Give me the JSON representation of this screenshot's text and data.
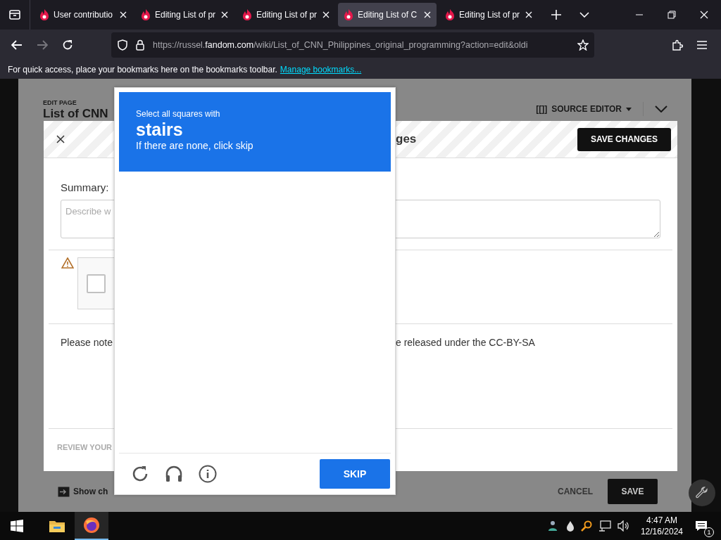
{
  "browser": {
    "tabs": [
      {
        "title": "User contributio",
        "selected": false
      },
      {
        "title": "Editing List of pr",
        "selected": false
      },
      {
        "title": "Editing List of pr",
        "selected": false
      },
      {
        "title": "Editing List of C",
        "selected": true
      },
      {
        "title": "Editing List of pr",
        "selected": false
      }
    ],
    "forward_disabled": true,
    "url": {
      "prefix": "https://russel.",
      "domain": "fandom.com",
      "path": "/wiki/List_of_CNN_Philippines_original_programming?action=edit&oldi"
    },
    "bookmarks_bar": {
      "message": "For quick access, place your bookmarks here on the bookmarks toolbar.",
      "link": "Manage bookmarks..."
    }
  },
  "editor": {
    "eyebrow": "EDIT PAGE",
    "title": "List of CNN",
    "mode_icon": "[[]]",
    "mode": "SOURCE EDITOR"
  },
  "save_dialog": {
    "title": "ges",
    "save_button": "SAVE CHANGES",
    "summary_label": "Summary:",
    "summary_placeholder": "Describe w",
    "captcha_checked": false,
    "notice_start": "Please note",
    "notice_end": "e released under the CC-BY-SA",
    "review_label": "REVIEW YOUR"
  },
  "footer": {
    "show_changes": "Show ch",
    "cancel": "CANCEL",
    "save": "SAVE"
  },
  "captcha": {
    "prompt": "Select all squares with",
    "target": "stairs",
    "hint": "If there are none, click skip",
    "skip_button": "SKIP"
  },
  "taskbar": {
    "time": "4:47 AM",
    "date": "12/16/2024",
    "notification_count": "1"
  }
}
